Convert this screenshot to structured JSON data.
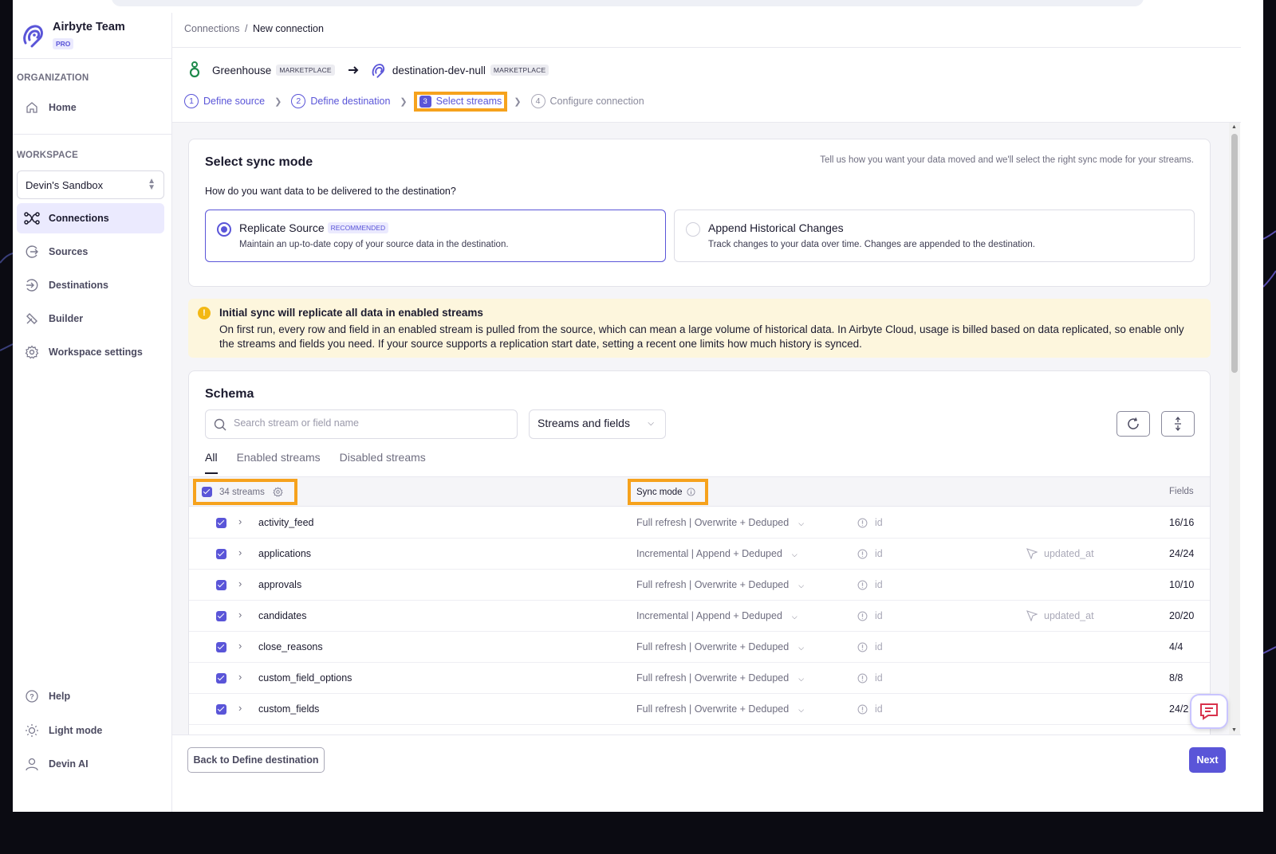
{
  "workspace_org": {
    "name": "Airbyte Team",
    "plan_badge": "PRO"
  },
  "sidebar": {
    "org_section": "ORGANIZATION",
    "home": "Home",
    "ws_section": "WORKSPACE",
    "workspace_select": "Devin's Sandbox",
    "items": [
      {
        "label": "Connections",
        "icon": "connections-icon"
      },
      {
        "label": "Sources",
        "icon": "source-icon"
      },
      {
        "label": "Destinations",
        "icon": "destination-icon"
      },
      {
        "label": "Builder",
        "icon": "builder-icon"
      },
      {
        "label": "Workspace settings",
        "icon": "gear-icon"
      }
    ],
    "bottom": [
      {
        "label": "Help",
        "icon": "help-icon"
      },
      {
        "label": "Light mode",
        "icon": "sun-icon"
      },
      {
        "label": "Devin AI",
        "icon": "user-icon"
      }
    ]
  },
  "breadcrumb": {
    "parent": "Connections",
    "separator": "/",
    "current": "New connection"
  },
  "connection": {
    "source": "Greenhouse",
    "source_badge": "MARKETPLACE",
    "destination": "destination-dev-null",
    "destination_badge": "MARKETPLACE"
  },
  "steps": [
    {
      "num": "1",
      "label": "Define source"
    },
    {
      "num": "2",
      "label": "Define destination"
    },
    {
      "num": "3",
      "label": "Select streams"
    },
    {
      "num": "4",
      "label": "Configure connection"
    }
  ],
  "sync_mode": {
    "title": "Select sync mode",
    "hint": "Tell us how you want your data moved and we'll select the right sync mode for your streams.",
    "question": "How do you want data to be delivered to the destination?",
    "options": [
      {
        "title": "Replicate Source",
        "badge": "RECOMMENDED",
        "desc": "Maintain an up-to-date copy of your source data in the destination.",
        "selected": true
      },
      {
        "title": "Append Historical Changes",
        "desc": "Track changes to your data over time. Changes are appended to the destination.",
        "selected": false
      }
    ]
  },
  "warning": {
    "title": "Initial sync will replicate all data in enabled streams",
    "body": "On first run, every row and field in an enabled stream is pulled from the source, which can mean a large volume of historical data. In Airbyte Cloud, usage is billed based on data replicated, so enable only the streams and fields you need. If your source supports a replication start date, setting a recent one limits how much history is synced."
  },
  "schema": {
    "title": "Schema",
    "search_placeholder": "Search stream or field name",
    "filter": "Streams and fields",
    "tabs": [
      "All",
      "Enabled streams",
      "Disabled streams"
    ],
    "header": {
      "streams": "34 streams",
      "sync_mode": "Sync mode",
      "fields": "Fields"
    },
    "rows": [
      {
        "name": "activity_feed",
        "sync": "Full refresh | Overwrite + Deduped",
        "pk": "id",
        "cursor": "",
        "fields": "16/16"
      },
      {
        "name": "applications",
        "sync": "Incremental | Append + Deduped",
        "pk": "id",
        "cursor": "updated_at",
        "fields": "24/24"
      },
      {
        "name": "approvals",
        "sync": "Full refresh | Overwrite + Deduped",
        "pk": "id",
        "cursor": "",
        "fields": "10/10"
      },
      {
        "name": "candidates",
        "sync": "Incremental | Append + Deduped",
        "pk": "id",
        "cursor": "updated_at",
        "fields": "20/20"
      },
      {
        "name": "close_reasons",
        "sync": "Full refresh | Overwrite + Deduped",
        "pk": "id",
        "cursor": "",
        "fields": "4/4"
      },
      {
        "name": "custom_field_options",
        "sync": "Full refresh | Overwrite + Deduped",
        "pk": "id",
        "cursor": "",
        "fields": "8/8"
      },
      {
        "name": "custom_fields",
        "sync": "Full refresh | Overwrite + Deduped",
        "pk": "id",
        "cursor": "",
        "fields": "24/2"
      }
    ]
  },
  "footer": {
    "back": "Back to Define destination",
    "next": "Next"
  },
  "colors": {
    "accent": "#5a55d8",
    "highlight": "#f6a21d",
    "warning_bg": "#fdf6dd"
  }
}
